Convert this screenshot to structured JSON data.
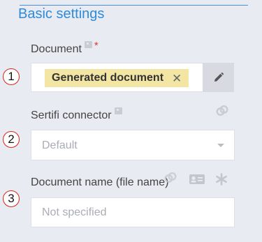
{
  "section": {
    "title": "Basic settings"
  },
  "fields": {
    "document": {
      "label": "Document",
      "required_mark": "*",
      "marker": "1",
      "tag_label": "Generated document",
      "tag_remove": "✕"
    },
    "connector": {
      "label": "Sertifi connector",
      "marker": "2",
      "placeholder": "Default"
    },
    "document_name": {
      "label": "Document name (file name)",
      "marker": "3",
      "placeholder": "Not specified"
    }
  },
  "icons": {
    "info": "info-icon",
    "edit": "pencil-icon",
    "connector_side": "link-chain-icon",
    "name_side": [
      "link-chain-icon",
      "address-card-icon",
      "asterisk-icon"
    ]
  },
  "colors": {
    "accent": "#2f8ad8",
    "tag_background": "#f3e6a4",
    "required": "#e0382c",
    "marker_border": "#d8231a",
    "page_background": "#e8ebf1"
  }
}
